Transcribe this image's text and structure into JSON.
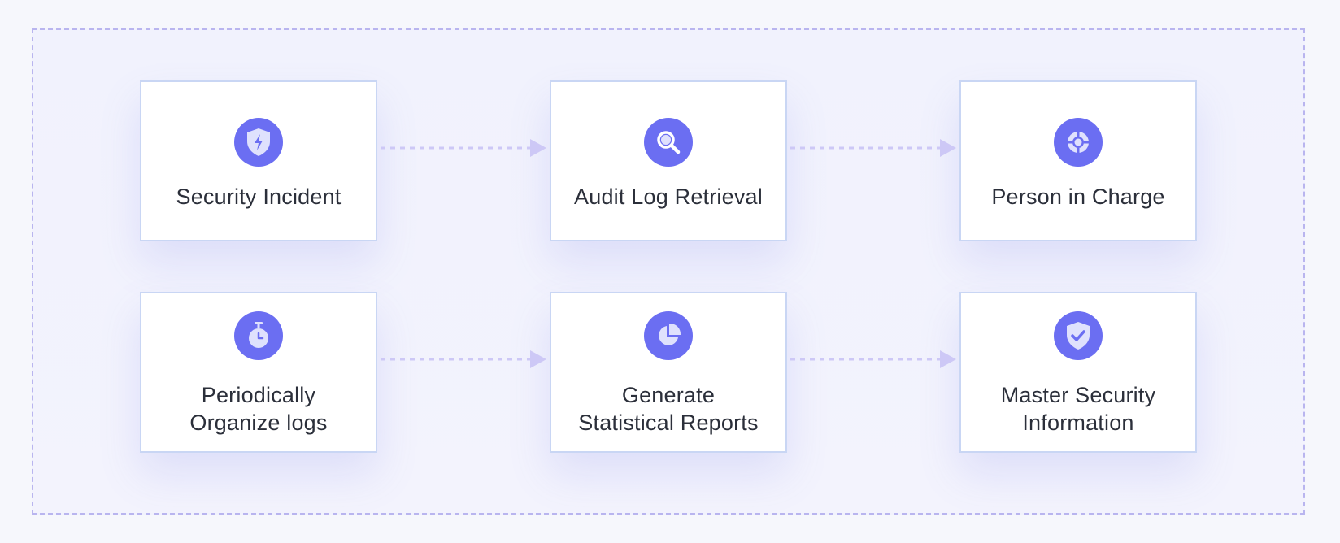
{
  "nodes": [
    {
      "id": "security-incident",
      "label": "Security Incident",
      "icon": "shield-bolt-icon"
    },
    {
      "id": "audit-log-retrieval",
      "label": "Audit Log Retrieval",
      "icon": "magnifier-icon"
    },
    {
      "id": "person-in-charge",
      "label": "Person in Charge",
      "icon": "target-icon"
    },
    {
      "id": "periodically-organize-logs",
      "label": "Periodically\nOrganize logs",
      "icon": "stopwatch-icon"
    },
    {
      "id": "generate-statistical-reports",
      "label": "Generate\nStatistical Reports",
      "icon": "pie-chart-icon"
    },
    {
      "id": "master-security-information",
      "label": "Master Security\nInformation",
      "icon": "shield-check-icon"
    }
  ],
  "edges": [
    {
      "from": "security-incident",
      "to": "audit-log-retrieval"
    },
    {
      "from": "audit-log-retrieval",
      "to": "person-in-charge"
    },
    {
      "from": "periodically-organize-logs",
      "to": "generate-statistical-reports"
    },
    {
      "from": "generate-statistical-reports",
      "to": "master-security-information"
    }
  ],
  "colors": {
    "accent": "#6b6ef2",
    "connector": "#cdc8f6",
    "frame_border": "#b9b5ef",
    "card_border": "#c9d6f4",
    "text": "#2b2f3a"
  }
}
